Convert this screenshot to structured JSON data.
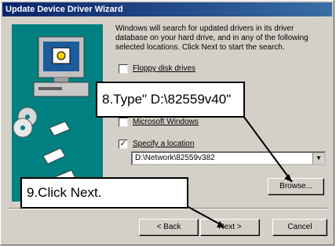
{
  "window": {
    "title": "Update Device Driver Wizard"
  },
  "intro": "Windows will search for updated drivers in its driver database on your hard drive, and in any of the following selected locations. Click Next to start the search.",
  "options": [
    {
      "label": "Floppy disk drives",
      "checked": false
    },
    {
      "label": "Microsoft Windows",
      "checked": false
    },
    {
      "label": "Specify a location",
      "checked": true
    }
  ],
  "location": {
    "value": "D:\\Network\\82559v382"
  },
  "buttons": {
    "browse": "Browse...",
    "back": "< Back",
    "next": "Next >",
    "cancel": "Cancel"
  },
  "callouts": {
    "step8": "8.Type\" D:\\82559v40\"",
    "step9": "9.Click Next."
  },
  "icons": {
    "check": "✓",
    "dropdown": "▼"
  },
  "colors": {
    "title_start": "#0a246a",
    "title_end": "#3a6ea5",
    "art_bg": "#008080"
  }
}
